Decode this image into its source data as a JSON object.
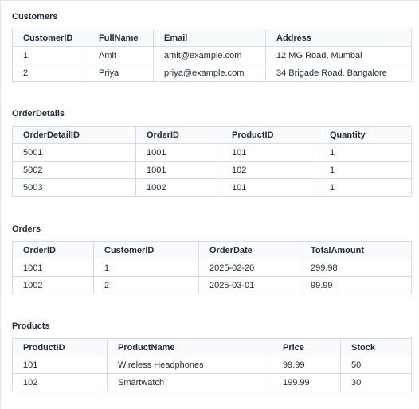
{
  "tables": [
    {
      "title": "Customers",
      "columns": [
        "CustomerID",
        "FullName",
        "Email",
        "Address"
      ],
      "rows": [
        [
          "1",
          "Amit",
          "amit@example.com",
          "12 MG Road, Mumbai"
        ],
        [
          "2",
          "Priya",
          "priya@example.com",
          "34 Brigade Road, Bangalore"
        ]
      ]
    },
    {
      "title": "OrderDetails",
      "columns": [
        "OrderDetailID",
        "OrderID",
        "ProductID",
        "Quantity"
      ],
      "rows": [
        [
          "5001",
          "1001",
          "101",
          "1"
        ],
        [
          "5002",
          "1001",
          "102",
          "1"
        ],
        [
          "5003",
          "1002",
          "101",
          "1"
        ]
      ]
    },
    {
      "title": "Orders",
      "columns": [
        "OrderID",
        "CustomerID",
        "OrderDate",
        "TotalAmount"
      ],
      "rows": [
        [
          "1001",
          "1",
          "2025-02-20",
          "299.98"
        ],
        [
          "1002",
          "2",
          "2025-03-01",
          "99.99"
        ]
      ]
    },
    {
      "title": "Products",
      "columns": [
        "ProductID",
        "ProductName",
        "Price",
        "Stock"
      ],
      "rows": [
        [
          "101",
          "Wireless Headphones",
          "99.99",
          "50"
        ],
        [
          "102",
          "Smartwatch",
          "199.99",
          "30"
        ]
      ]
    }
  ]
}
